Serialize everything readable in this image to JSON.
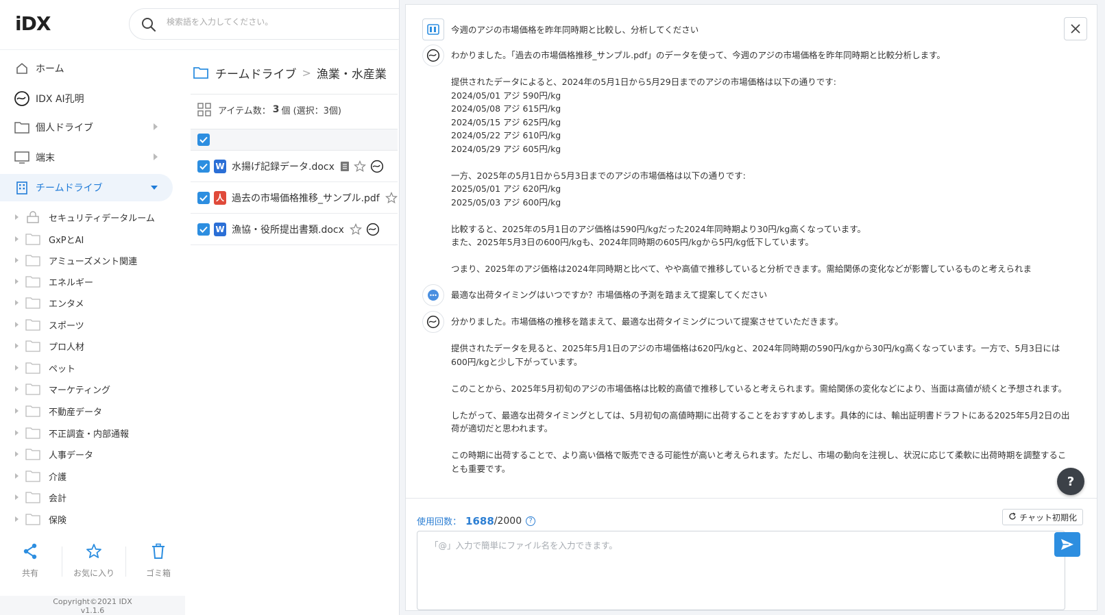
{
  "brand": {
    "logo": "iDX"
  },
  "search": {
    "placeholder": "検索語を入力してください。"
  },
  "sidebar": {
    "items": [
      {
        "label": "ホーム",
        "icon": "home-icon"
      },
      {
        "label": "IDX AI孔明",
        "icon": "ai-kongming-icon"
      },
      {
        "label": "個人ドライブ",
        "icon": "folder-icon"
      },
      {
        "label": "端末",
        "icon": "monitor-icon"
      },
      {
        "label": "チームドライブ",
        "icon": "building-icon"
      }
    ],
    "folders": [
      "セキュリティデータルーム",
      "GxPとAI",
      "アミューズメント関連",
      "エネルギー",
      "エンタメ",
      "スポーツ",
      "プロ人材",
      "ペット",
      "マーケティング",
      "不動産データ",
      "不正調査・内部通報",
      "人事データ",
      "介護",
      "会計",
      "保険"
    ],
    "actions": {
      "share": "共有",
      "favorite": "お気に入り",
      "trash": "ゴミ箱"
    },
    "copyright": "Copyright©2021 IDX",
    "version": "v1.1.6"
  },
  "main": {
    "breadcrumb": [
      "チームドライブ",
      "漁業・水産業"
    ],
    "item_count_label": "アイテム数：",
    "item_count": "3",
    "item_count_suffix": "個 (選択：3個)",
    "files": [
      {
        "name": "水揚げ記録データ.docx",
        "type": "word"
      },
      {
        "name": "過去の市場価格推移_サンプル.pdf",
        "type": "pdf"
      },
      {
        "name": "漁協・役所提出書類.docx",
        "type": "word"
      }
    ]
  },
  "chat": {
    "messages": [
      {
        "role": "user",
        "text": "今週のアジの市場価格を昨年同時期と比較し、分析してください"
      },
      {
        "role": "ai",
        "text": "わかりました。「過去の市場価格推移_サンプル.pdf」のデータを使って、今週のアジの市場価格を昨年同時期と比較分析します。\n\n提供されたデータによると、2024年の5月1日から5月29日までのアジの市場価格は以下の通りです:\n2024/05/01 アジ 590円/kg\n2024/05/08 アジ 615円/kg\n2024/05/15 アジ 625円/kg\n2024/05/22 アジ 610円/kg\n2024/05/29 アジ 605円/kg\n\n一方、2025年の5月1日から5月3日までのアジの市場価格は以下の通りです:\n2025/05/01 アジ 620円/kg\n2025/05/03 アジ 600円/kg\n\n比較すると、2025年の5月1日のアジ価格は590円/kgだった2024年同時期より30円/kg高くなっています。\nまた、2025年5月3日の600円/kgも、2024年同時期の605円/kgから5円/kg低下しています。\n\nつまり、2025年のアジ価格は2024年同時期と比べて、やや高値で推移していると分析できます。需給関係の変化などが影響しているものと考えられま"
      },
      {
        "role": "user",
        "text": "最適な出荷タイミングはいつですか？市場価格の予測を踏まえて提案してください"
      },
      {
        "role": "ai",
        "text": "分かりました。市場価格の推移を踏まえて、最適な出荷タイミングについて提案させていただきます。\n\n提供されたデータを見ると、2025年5月1日のアジの市場価格は620円/kgと、2024年同時期の590円/kgから30円/kg高くなっています。一方で、5月3日には600円/kgと少し下がっています。\n\nこのことから、2025年5月初旬のアジの市場価格は比較的高値で推移していると考えられます。需給関係の変化などにより、当面は高値が続くと予想されます。\n\nしたがって、最適な出荷タイミングとしては、5月初旬の高値時期に出荷することをおすすめします。具体的には、輸出証明書ドラフトにある2025年5月2日の出荷が適切だと思われます。\n\nこの時期に出荷することで、より高い価格で販売できる可能性が高いと考えられます。ただし、市場の動向を注視し、状況に応じて柔軟に出荷時期を調整することも重要です。"
      }
    ],
    "usage_label": "使用回数：",
    "usage_count": "1688",
    "usage_total": "/2000",
    "reset_label": "チャット初期化",
    "input_placeholder": "「@」入力で簡単にファイル名を入力できます。"
  },
  "colors": {
    "accent": "#2d8ee0",
    "active_nav": "#1f7bd8"
  }
}
